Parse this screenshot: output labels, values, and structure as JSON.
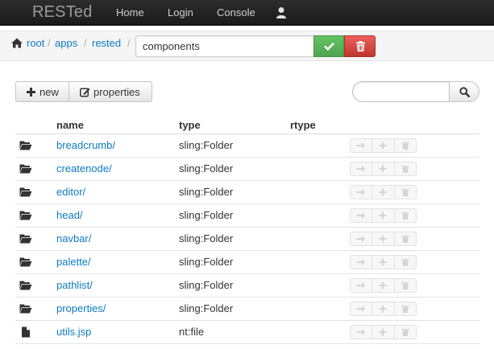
{
  "navbar": {
    "brand": "RESTed",
    "links": [
      "Home",
      "Login",
      "Console"
    ],
    "user_icon": "user-icon"
  },
  "pathbar": {
    "home_icon": "home-icon",
    "crumbs": [
      "root",
      "apps",
      "rested"
    ],
    "separator": "/",
    "path_value": "components",
    "ok_icon": "checkmark-icon",
    "delete_icon": "trash-icon",
    "ok_color": "#5bb75b",
    "delete_color": "#da4f49"
  },
  "toolbar": {
    "new_label": "new",
    "properties_label": "properties",
    "search_value": "",
    "search_icon": "search-icon"
  },
  "table": {
    "headers": [
      "name",
      "type",
      "rtype"
    ],
    "rows": [
      {
        "icon": "folder-icon",
        "name": "breadcrumb/",
        "type": "sling:Folder",
        "rtype": ""
      },
      {
        "icon": "folder-icon",
        "name": "createnode/",
        "type": "sling:Folder",
        "rtype": ""
      },
      {
        "icon": "folder-icon",
        "name": "editor/",
        "type": "sling:Folder",
        "rtype": ""
      },
      {
        "icon": "folder-icon",
        "name": "head/",
        "type": "sling:Folder",
        "rtype": ""
      },
      {
        "icon": "folder-icon",
        "name": "navbar/",
        "type": "sling:Folder",
        "rtype": ""
      },
      {
        "icon": "folder-icon",
        "name": "palette/",
        "type": "sling:Folder",
        "rtype": ""
      },
      {
        "icon": "folder-icon",
        "name": "pathlist/",
        "type": "sling:Folder",
        "rtype": ""
      },
      {
        "icon": "folder-icon",
        "name": "properties/",
        "type": "sling:Folder",
        "rtype": ""
      },
      {
        "icon": "file-icon",
        "name": "utils.jsp",
        "type": "nt:file",
        "rtype": ""
      }
    ],
    "row_action_icons": [
      "arrow-right-icon",
      "plus-icon",
      "trash-icon"
    ],
    "link_color": "#0d7bc4"
  }
}
